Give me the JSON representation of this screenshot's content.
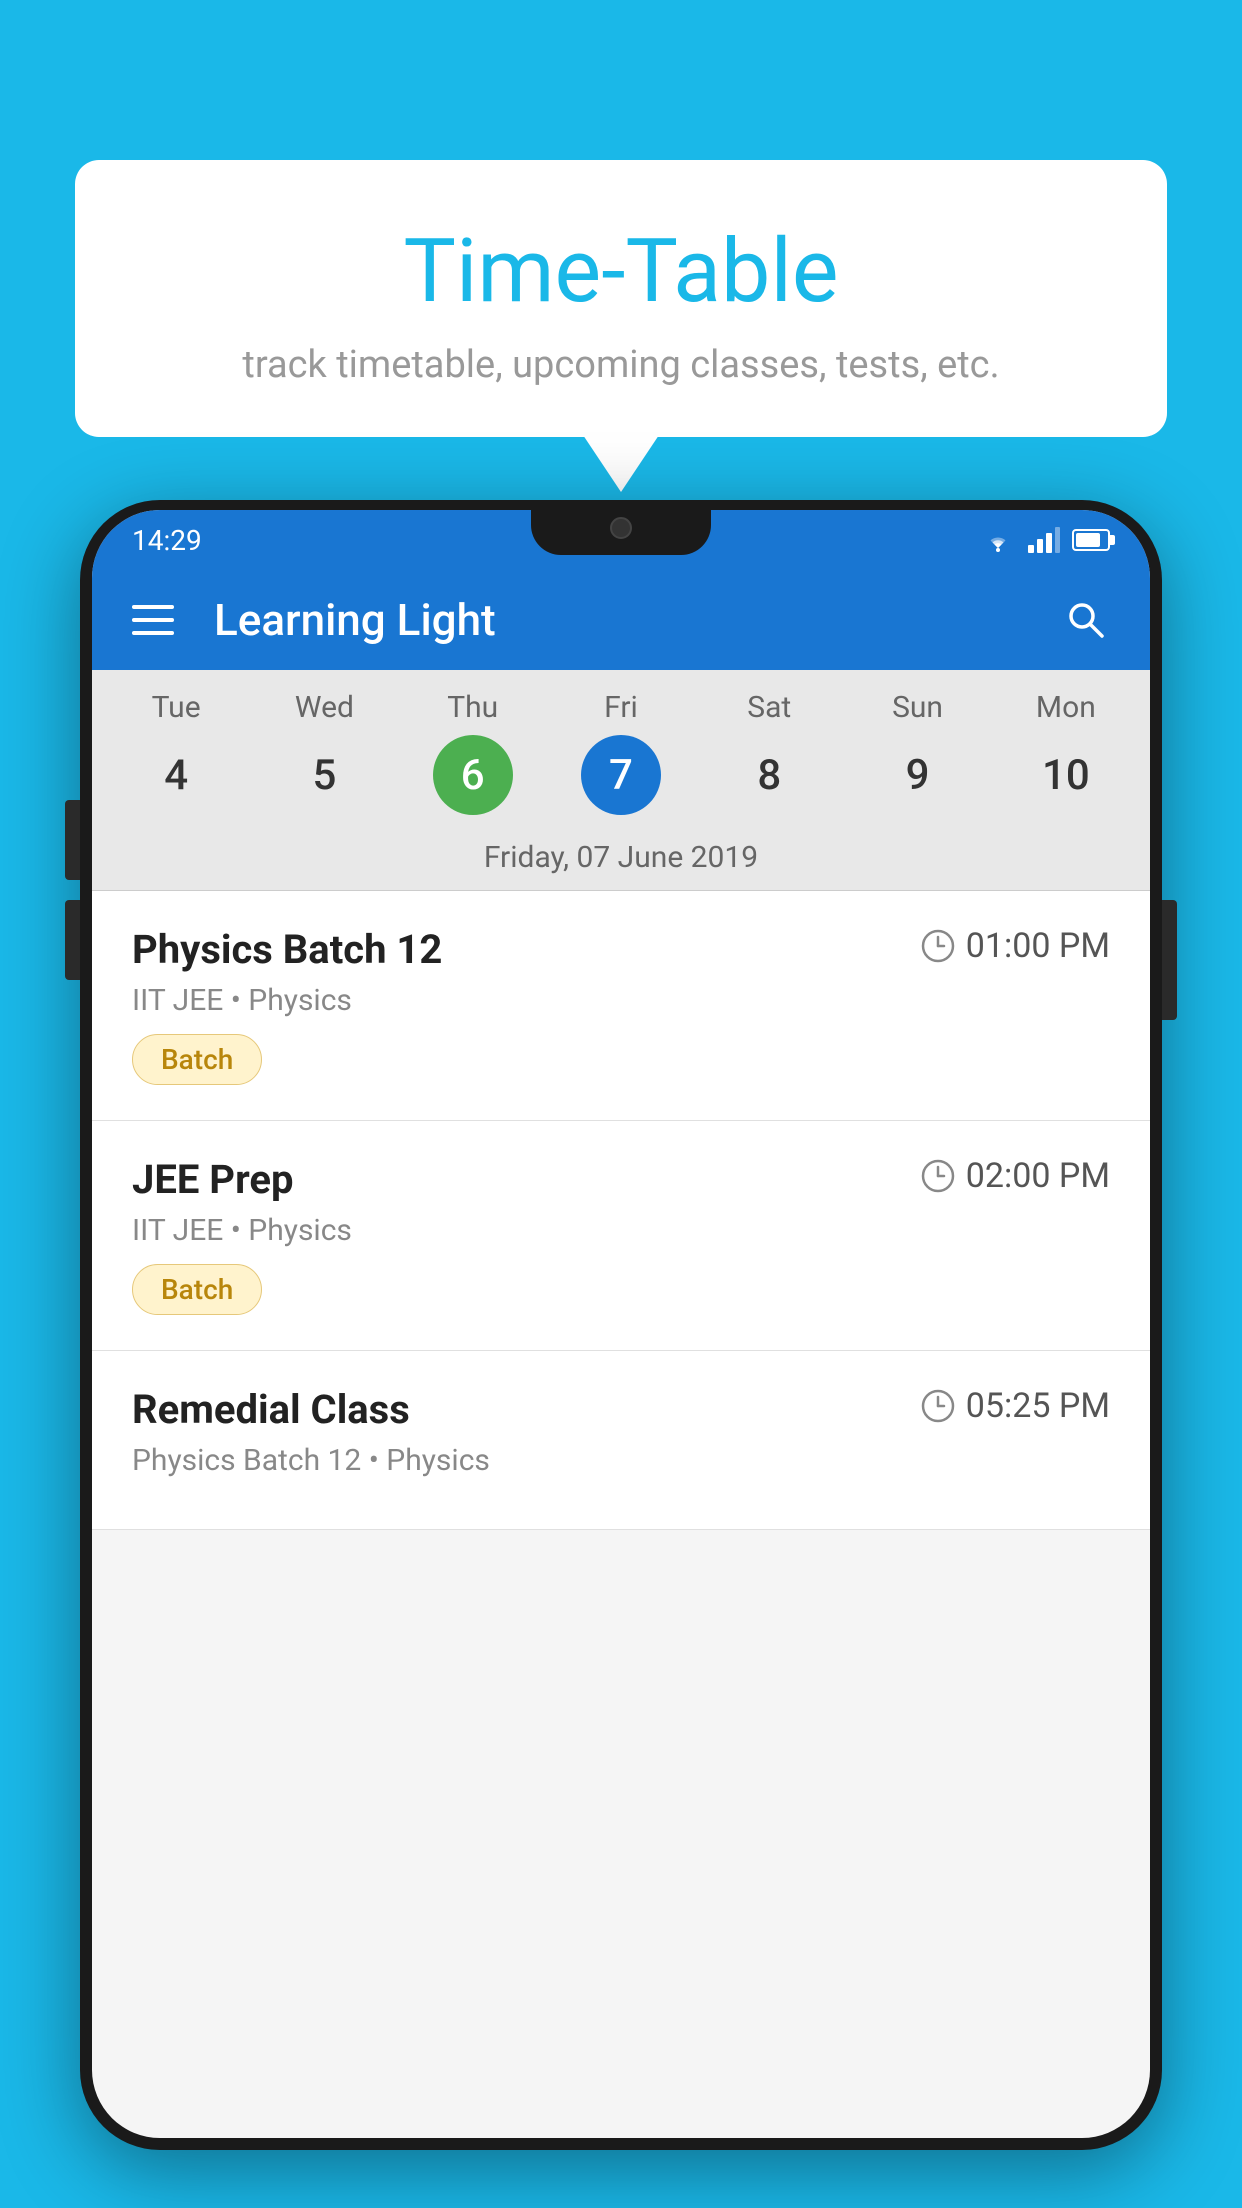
{
  "background_color": "#1ab8e8",
  "speech_bubble": {
    "title": "Time-Table",
    "subtitle": "track timetable, upcoming classes, tests, etc."
  },
  "phone": {
    "status_bar": {
      "time": "14:29"
    },
    "app_bar": {
      "title": "Learning Light"
    },
    "calendar": {
      "days": [
        {
          "label": "Tue",
          "number": "4"
        },
        {
          "label": "Wed",
          "number": "5"
        },
        {
          "label": "Thu",
          "number": "6",
          "state": "today"
        },
        {
          "label": "Fri",
          "number": "7",
          "state": "selected"
        },
        {
          "label": "Sat",
          "number": "8"
        },
        {
          "label": "Sun",
          "number": "9"
        },
        {
          "label": "Mon",
          "number": "10"
        }
      ],
      "selected_date_label": "Friday, 07 June 2019"
    },
    "schedule": [
      {
        "name": "Physics Batch 12",
        "time": "01:00 PM",
        "sub": "IIT JEE • Physics",
        "tag": "Batch"
      },
      {
        "name": "JEE Prep",
        "time": "02:00 PM",
        "sub": "IIT JEE • Physics",
        "tag": "Batch"
      },
      {
        "name": "Remedial Class",
        "time": "05:25 PM",
        "sub": "Physics Batch 12 • Physics",
        "tag": ""
      }
    ]
  }
}
